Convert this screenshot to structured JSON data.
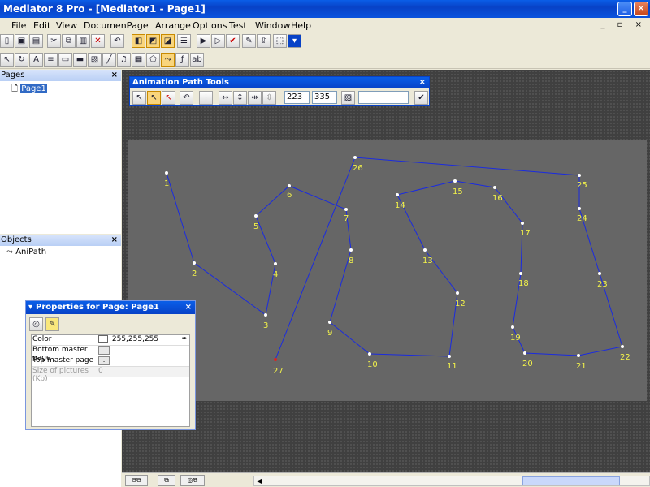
{
  "window": {
    "title": "Mediator 8 Pro - [Mediator1 - Page1]"
  },
  "menu": [
    "File",
    "Edit",
    "View",
    "Document",
    "Page",
    "Arrange",
    "Options",
    "Test",
    "Window",
    "Help"
  ],
  "panes": {
    "pages": {
      "title": "Pages",
      "items": [
        "Page1"
      ]
    },
    "objects": {
      "title": "Objects",
      "items": [
        "AniPath"
      ]
    }
  },
  "animation_path_tools": {
    "title": "Animation Path Tools",
    "x_value": "223",
    "y_value": "335",
    "extra_value": ""
  },
  "properties": {
    "title": "Properties for Page: Page1",
    "rows": [
      {
        "label": "Color",
        "value": "255,255,255",
        "swatch": "#ffffff"
      },
      {
        "label": "Bottom master page",
        "value": ""
      },
      {
        "label": "Top master page",
        "value": ""
      },
      {
        "label": "Size of pictures (Kb)",
        "value": "0"
      }
    ]
  },
  "colors": {
    "path_line": "#1a2be0",
    "point_label": "#f2f24a",
    "point": "#ffffff",
    "start_point": "#e02020"
  },
  "path_points": [
    {
      "label": "1"
    },
    {
      "label": "2"
    },
    {
      "label": "3"
    },
    {
      "label": "4"
    },
    {
      "label": "5"
    },
    {
      "label": "6"
    },
    {
      "label": "7"
    },
    {
      "label": "8"
    },
    {
      "label": "9"
    },
    {
      "label": "10"
    },
    {
      "label": "11"
    },
    {
      "label": "12"
    },
    {
      "label": "13"
    },
    {
      "label": "14"
    },
    {
      "label": "15"
    },
    {
      "label": "16"
    },
    {
      "label": "17"
    },
    {
      "label": "18"
    },
    {
      "label": "19"
    },
    {
      "label": "20"
    },
    {
      "label": "21"
    },
    {
      "label": "22"
    },
    {
      "label": "23"
    },
    {
      "label": "24"
    },
    {
      "label": "25"
    },
    {
      "label": "26"
    },
    {
      "label": "27"
    }
  ]
}
